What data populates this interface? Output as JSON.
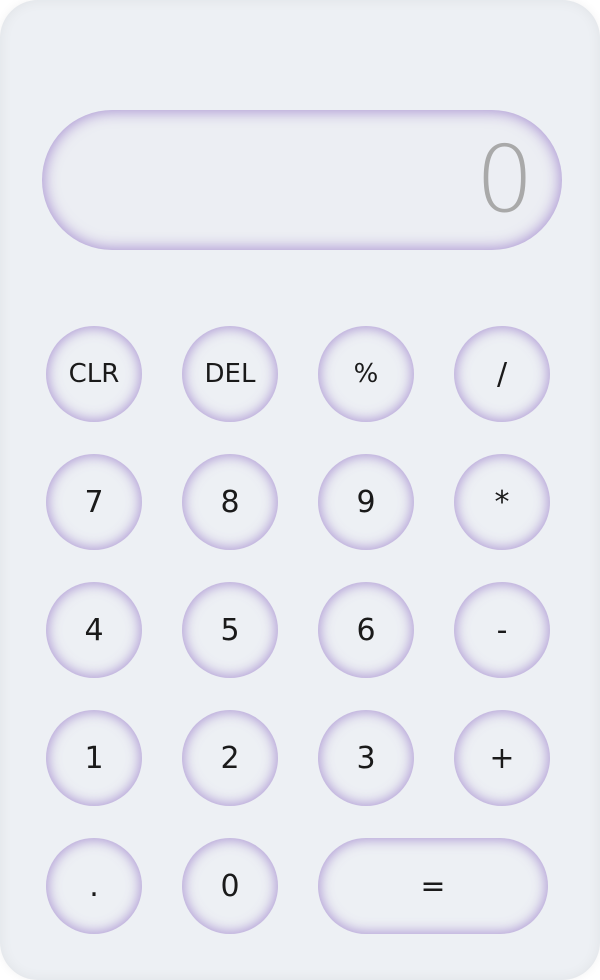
{
  "display": {
    "value": "0"
  },
  "keys": {
    "clear": "CLR",
    "delete": "DEL",
    "percent": "%",
    "divide": "/",
    "seven": "7",
    "eight": "8",
    "nine": "9",
    "multiply": "*",
    "four": "4",
    "five": "5",
    "six": "6",
    "subtract": "-",
    "one": "1",
    "two": "2",
    "three": "3",
    "add": "+",
    "decimal": ".",
    "zero": "0",
    "equals": "="
  },
  "colors": {
    "body": "#edf0f4",
    "glow": "#9678c8",
    "display_text": "#a9a9a9",
    "key_text": "#1a1a1a"
  }
}
